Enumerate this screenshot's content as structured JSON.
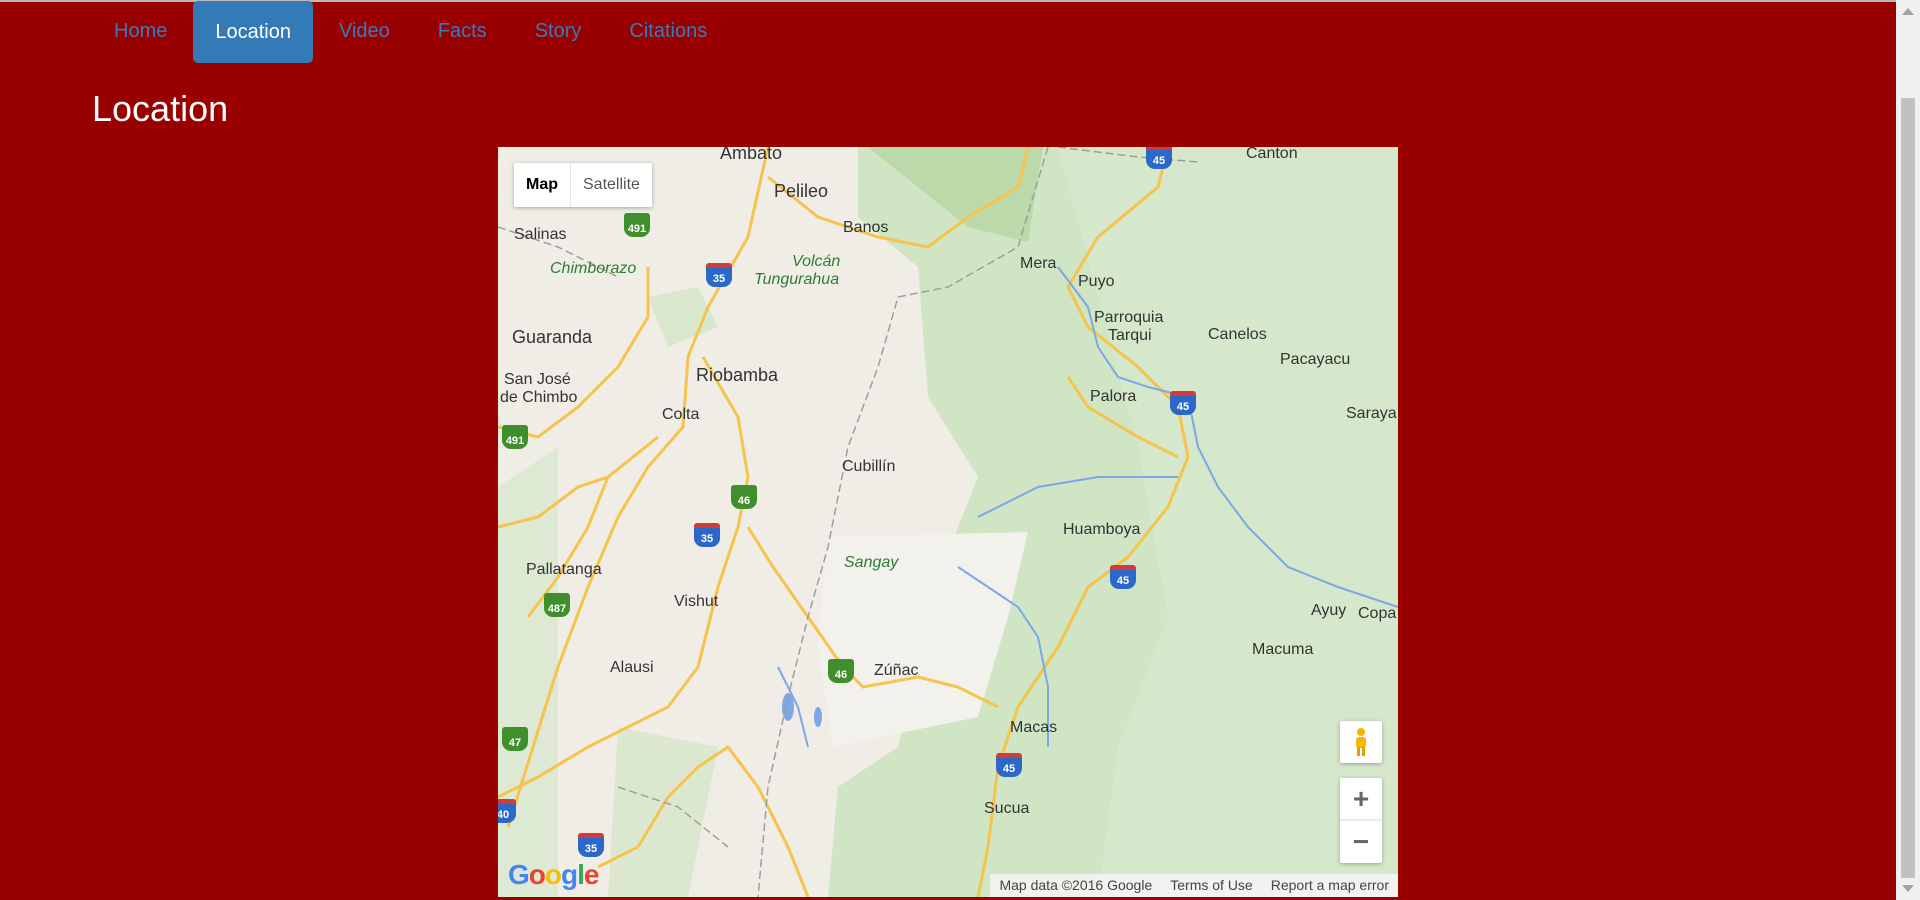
{
  "nav": {
    "items": [
      {
        "label": "Home"
      },
      {
        "label": "Location"
      },
      {
        "label": "Video"
      },
      {
        "label": "Facts"
      },
      {
        "label": "Story"
      },
      {
        "label": "Citations"
      }
    ],
    "active": "Location"
  },
  "page": {
    "title": "Location"
  },
  "map": {
    "type_buttons": {
      "map": "Map",
      "satellite": "Satellite"
    },
    "zoom": {
      "in": "+",
      "out": "−"
    },
    "logo": "Google",
    "attribution": {
      "data": "Map data ©2016 Google",
      "terms": "Terms of Use",
      "report": "Report a map error"
    },
    "places": {
      "ambato": "Ambato",
      "pelileo": "Pelileo",
      "banos": "Banos",
      "salinas": "Salinas",
      "chimborazo": "Chimborazo",
      "volcan_1": "Volcán",
      "volcan_2": "Tungurahua",
      "mera": "Mera",
      "puyo": "Puyo",
      "parroquia": "Parroquia",
      "tarqui": "Tarqui",
      "canelos": "Canelos",
      "pacayacu": "Pacayacu",
      "guaranda": "Guaranda",
      "san_jose_1": "San José",
      "san_jose_2": "de Chimbo",
      "riobamba": "Riobamba",
      "colta": "Colta",
      "palora": "Palora",
      "sarayacu": "Saraya",
      "cubillin": "Cubillín",
      "huamboya": "Huamboya",
      "sangay": "Sangay",
      "pallatanga": "Pallatanga",
      "vishut": "Vishut",
      "ayuy": "Ayuy",
      "copa": "Copa",
      "macuma": "Macuma",
      "alausi": "Alausi",
      "zunac": "Zúñac",
      "macas": "Macas",
      "sucua": "Sucua",
      "canton": "Canton"
    },
    "shields": {
      "r491a": "491",
      "r35a": "35",
      "r45a": "45",
      "r45b": "45",
      "r491b": "491",
      "r46a": "46",
      "r35b": "35",
      "r45c": "45",
      "r487": "487",
      "r46b": "46",
      "r47": "47",
      "r45d": "45",
      "r35c": "35",
      "r40": "40"
    }
  },
  "colors": {
    "background": "#990000",
    "nav_active": "#337ab7",
    "nav_link": "#3b78bd"
  }
}
